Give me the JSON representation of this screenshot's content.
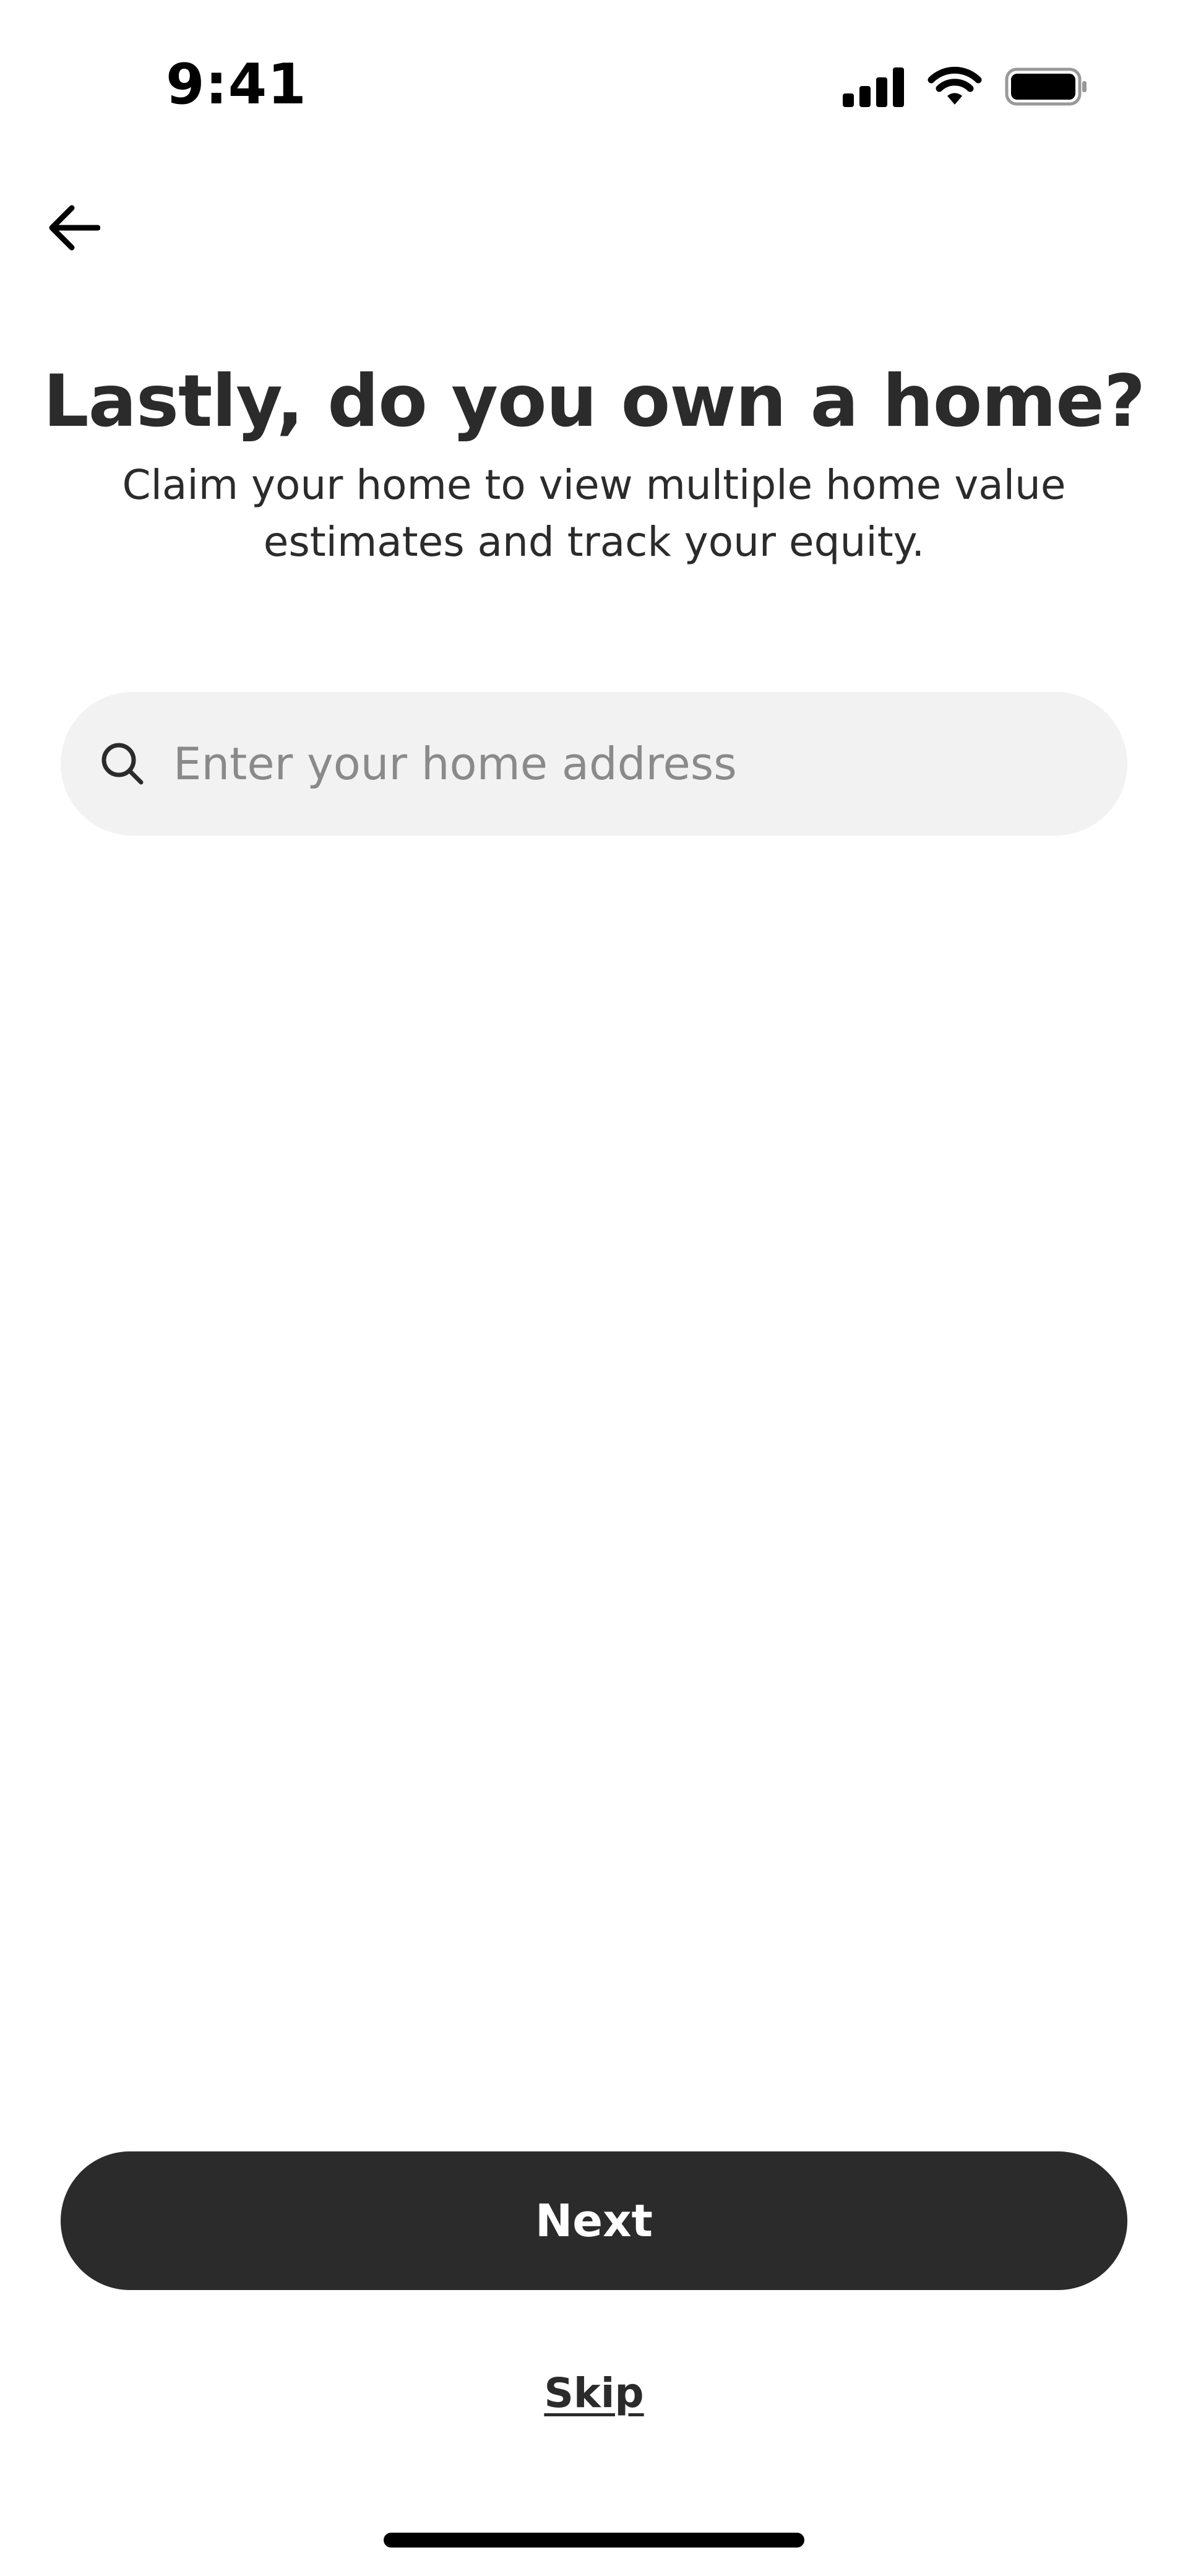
{
  "status_bar": {
    "time": "9:41",
    "icons": [
      "cellular-signal-icon",
      "wifi-icon",
      "battery-icon"
    ]
  },
  "nav": {
    "back_icon": "arrow-left-icon"
  },
  "header": {
    "title": "Lastly, do you own a home?",
    "subtitle_line1": "Claim your home to view multiple home value",
    "subtitle_line2": "estimates and track your equity."
  },
  "search": {
    "icon": "search-icon",
    "value": "",
    "placeholder": "Enter your home address"
  },
  "actions": {
    "next_label": "Next",
    "skip_label": "Skip"
  },
  "colors": {
    "primary_button": "#2b2b2b",
    "primary_button_text": "#ffffff",
    "input_background": "#f2f2f2",
    "placeholder_text": "#8a8a8a",
    "body_text": "#2b2b2b"
  }
}
